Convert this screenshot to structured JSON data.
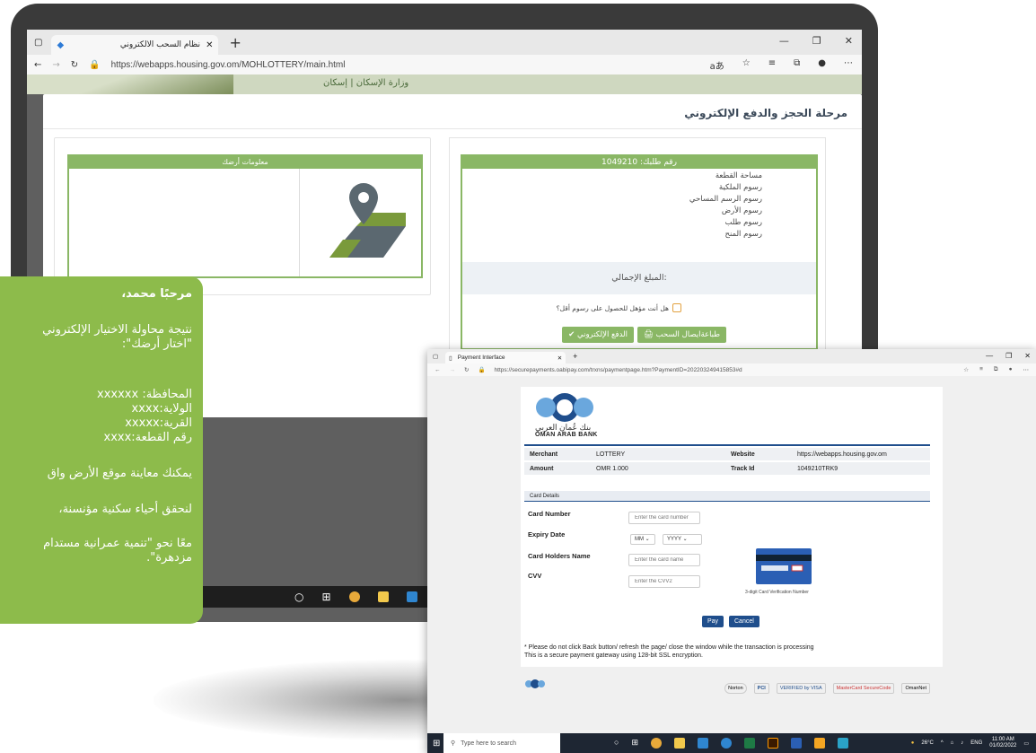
{
  "back_browser": {
    "tab_title": "نظام السحب الالكتروني",
    "url": "https://webapps.housing.gov.om/MOHLOTTERY/main.html",
    "header_logo": "وزارة الإسكان | إسكان"
  },
  "modal": {
    "title": "مرحلة الحجز والدفع الإلكتروني",
    "land_info_title": "معلومات أرضك",
    "order_title": "رقم طلبك: 1049210",
    "fees": [
      "مساحة القطعة",
      "رسوم الملكية",
      "رسوم الرسم المساحي",
      "رسوم الأرض",
      "رسوم طلب",
      "رسوم المنح"
    ],
    "total_label": "المبلغ الإجمالي:",
    "question": "هل أنت مؤهل للحصول على رسوم أقل؟",
    "btn_pay": "الدفع الإلكتروني",
    "btn_print": "طباعةايصال السحب"
  },
  "message": {
    "greeting": "مرحبًا محمد،",
    "line1": "نتيجة محاولة الاختيار الإلكتروني",
    "line2": "\"اختار أرضك\":",
    "gov": "المحافظة: xxxxxx",
    "wilayat": "الولاية:xxxx",
    "village": "القرية:xxxxx",
    "plot": "رقم القطعة:xxxx",
    "visit": "يمكنك معاينة موقع الأرض واق",
    "achieve": "لنحقق أحياء سكنية مؤنسنة،",
    "together1": "معًا نحو \"تنمية عمرانية مستدام",
    "together2": "مزدهرة\"."
  },
  "pay_browser": {
    "tab_title": "Payment Interface",
    "url": "https://securepayments.oabipay.com/trxns/paymentpage.htm?PaymentID=202203249415853#d",
    "bank_ar": "بنك عُمان العربي",
    "bank_en": "OMAN ARAB BANK",
    "merchant_label": "Merchant",
    "merchant": "LOTTERY",
    "website_label": "Website",
    "website": "https://webapps.housing.gov.om",
    "amount_label": "Amount",
    "amount": "OMR 1.000",
    "track_label": "Track Id",
    "track": "1049210TRK9",
    "card_details": "Card Details",
    "card_number_label": "Card Number",
    "card_number_ph": "Enter the card number",
    "expiry_label": "Expiry Date",
    "expiry_month": "MM",
    "expiry_year": "YYYY",
    "holder_label": "Card Holders Name",
    "holder_ph": "Enter the card name",
    "cvv_label": "CVV",
    "cvv_ph": "Enter the CVV2",
    "cvv_caption": "3-digit Card Verification Number",
    "pay_btn": "Pay",
    "cancel_btn": "Cancel",
    "notice1": "* Please do not click Back button/ refresh the page/ close the window while the transaction is processing",
    "notice2": "This is a secure payment gateway using 128-bit SSL encryption.",
    "badges": [
      "Norton",
      "PCI",
      "VERIFIED by VISA",
      "MasterCard SecureCode",
      "OmanNet"
    ]
  },
  "taskbar": {
    "search": "Type here to search",
    "weather": "26°C",
    "lang": "ENG",
    "time": "11:00 AM",
    "date": "01/02/2022"
  },
  "colors": {
    "accent_green": "#8dbb4b",
    "panel_green": "#8ab765",
    "bank_blue": "#1f4e8c"
  }
}
